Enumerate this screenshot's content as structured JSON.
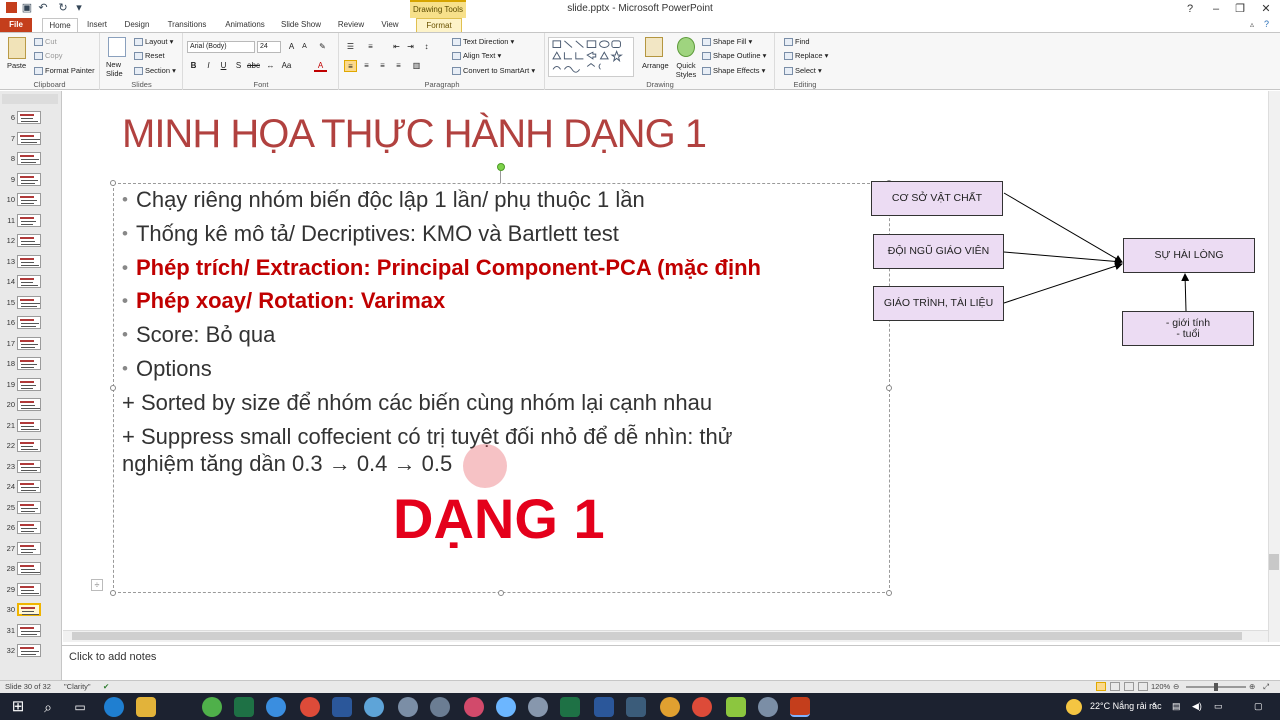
{
  "app": {
    "title": "slide.pptx - Microsoft PowerPoint",
    "context_tab": "Drawing Tools"
  },
  "tabs": [
    "File",
    "Home",
    "Insert",
    "Design",
    "Transitions",
    "Animations",
    "Slide Show",
    "Review",
    "View",
    "Format"
  ],
  "ribbon": {
    "clipboard": {
      "paste": "Paste",
      "cut": "Cut",
      "copy": "Copy",
      "format_painter": "Format Painter",
      "label": "Clipboard"
    },
    "slides": {
      "new_slide": "New Slide",
      "layout": "Layout",
      "reset": "Reset",
      "section": "Section",
      "label": "Slides"
    },
    "font": {
      "font_name": "Arial (Body)",
      "font_size": "24",
      "label": "Font"
    },
    "paragraph": {
      "text_direction": "Text Direction",
      "align_text": "Align Text",
      "convert": "Convert to SmartArt",
      "label": "Paragraph"
    },
    "drawing": {
      "arrange": "Arrange",
      "quick_styles": "Quick Styles",
      "shape_fill": "Shape Fill",
      "shape_outline": "Shape Outline",
      "shape_effects": "Shape Effects",
      "label": "Drawing"
    },
    "editing": {
      "find": "Find",
      "replace": "Replace",
      "select": "Select",
      "label": "Editing"
    }
  },
  "thumbnails": {
    "numbers": [
      "6",
      "7",
      "8",
      "9",
      "10",
      "11",
      "12",
      "13",
      "14",
      "15",
      "16",
      "17",
      "18",
      "19",
      "20",
      "21",
      "22",
      "23",
      "24",
      "25",
      "26",
      "27",
      "28",
      "29",
      "30",
      "31",
      "32"
    ],
    "selected": "30"
  },
  "slide": {
    "title": "MINH HỌA THỰC HÀNH DẠNG 1",
    "bullets": [
      "Chạy riêng nhóm biến độc lập 1 lần/ phụ thuộc 1 lần",
      "Thống kê mô tả/ Decriptives: KMO và Bartlett test",
      "Phép trích/ Extraction: Principal Component-PCA (mặc định",
      "Phép xoay/ Rotation: Varimax",
      "Score: Bỏ qua",
      "Options"
    ],
    "plain_lines": [
      "+ Sorted by size để nhóm các biến cùng nhóm lại cạnh nhau",
      "+ Suppress small coffecient có trị tuyệt đối nhỏ để dễ nhìn: thử",
      "nghiệm tăng dần 0.3 → 0.4 → 0.5"
    ],
    "big_label": "DẠNG 1",
    "diagram": {
      "box1": "CƠ SỞ VẬT CHẤT",
      "box2": "ĐỘI NGŨ GIÁO VIÊN",
      "box3": "GIÁO TRÌNH, TÀI LIỆU",
      "target": "SỰ HÀI LÒNG",
      "control_line1": "- giới tính",
      "control_line2": "- tuổi"
    }
  },
  "notes": {
    "placeholder": "Click to add notes"
  },
  "status": {
    "slide_info": "Slide 30 of 32",
    "theme": "\"Clarity\"",
    "zoom": "120%"
  },
  "taskbar": {
    "weather": "22°C  Nắng rải rác"
  },
  "colors": {
    "title": "#b1413f",
    "accent_red": "#c00000",
    "big_red": "#e4001b",
    "box_fill": "#ecdcf3",
    "file_tab": "#c43e1c"
  }
}
